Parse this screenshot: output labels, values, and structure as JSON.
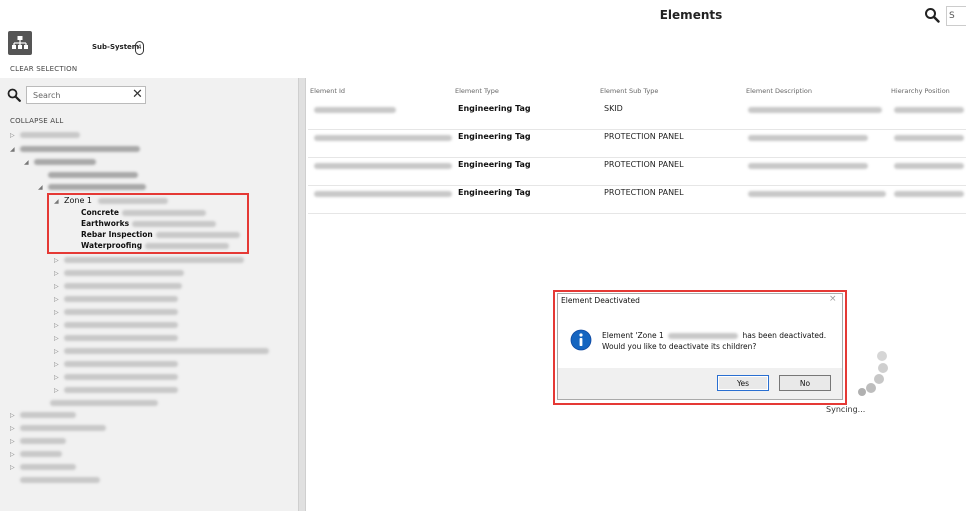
{
  "header": {
    "title": "Elements",
    "search_text": "S"
  },
  "toolbar": {
    "subsystem_label": "Sub-System",
    "subsystem_count": "4",
    "clear_selection": "CLEAR SELECTION"
  },
  "sidebar": {
    "search_placeholder": "Search",
    "clear_glyph": "✕",
    "collapse_all": "COLLAPSE ALL",
    "zone_label": "Zone 1",
    "children": [
      "Concrete",
      "Earthworks",
      "Rebar Inspection",
      "Waterproofing"
    ]
  },
  "grid": {
    "columns": [
      "Element Id",
      "Element Type",
      "Element Sub Type",
      "Element Description",
      "Hierarchy Position"
    ],
    "rows": [
      {
        "type": "Engineering Tag",
        "sub_type": "SKID"
      },
      {
        "type": "Engineering Tag",
        "sub_type": "PROTECTION PANEL"
      },
      {
        "type": "Engineering Tag",
        "sub_type": "PROTECTION PANEL"
      },
      {
        "type": "Engineering Tag",
        "sub_type": "PROTECTION PANEL"
      }
    ]
  },
  "dialog": {
    "title": "Element Deactivated",
    "close_glyph": "×",
    "line1_prefix": "Element 'Zone 1",
    "line1_suffix": "has been deactivated.",
    "line2": "Would you like to deactivate its children?",
    "yes_label": "Yes",
    "no_label": "No"
  },
  "status": {
    "syncing": "Syncing..."
  },
  "colors": {
    "highlight": "#e53935",
    "info_blue": "#1565c0",
    "panel_bg": "#f1f1f1"
  }
}
